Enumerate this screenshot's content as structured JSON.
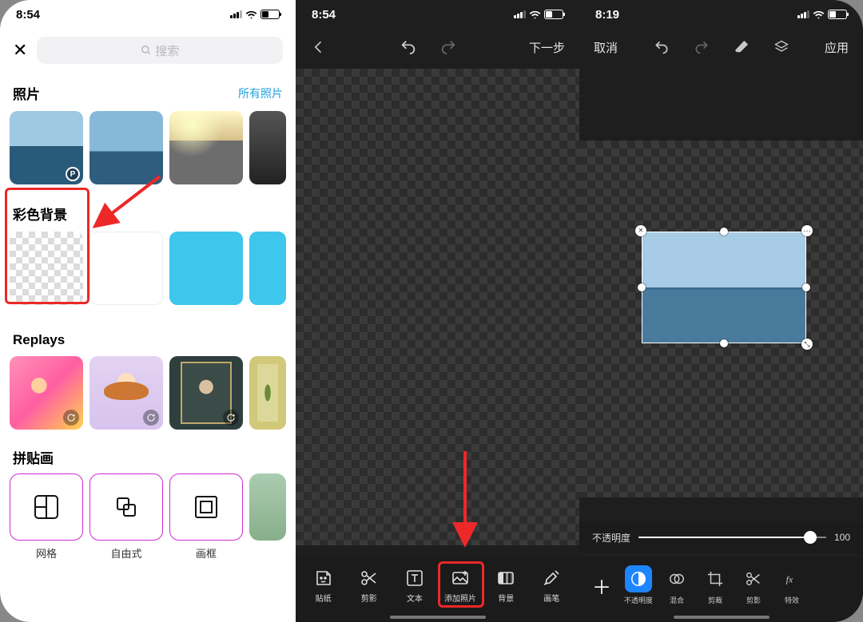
{
  "screen1": {
    "time": "8:54",
    "search_placeholder": "搜索",
    "photos_title": "照片",
    "all_photos": "所有照片",
    "color_bg_title": "彩色背景",
    "replays_title": "Replays",
    "collage_title": "拼贴画",
    "collage_labels": [
      "网格",
      "自由式",
      "画框"
    ]
  },
  "screen2": {
    "time": "8:54",
    "next": "下一步",
    "tools": [
      {
        "label": "贴纸"
      },
      {
        "label": "剪影"
      },
      {
        "label": "文本"
      },
      {
        "label": "添加照片"
      },
      {
        "label": "背景"
      },
      {
        "label": "画笔"
      }
    ]
  },
  "screen3": {
    "time": "8:19",
    "cancel": "取消",
    "apply": "应用",
    "opacity_label": "不透明度",
    "opacity_value": "100",
    "tools": [
      {
        "label": "不透明度"
      },
      {
        "label": "混合"
      },
      {
        "label": "剪裁"
      },
      {
        "label": "剪影"
      },
      {
        "label": "特效"
      }
    ]
  }
}
